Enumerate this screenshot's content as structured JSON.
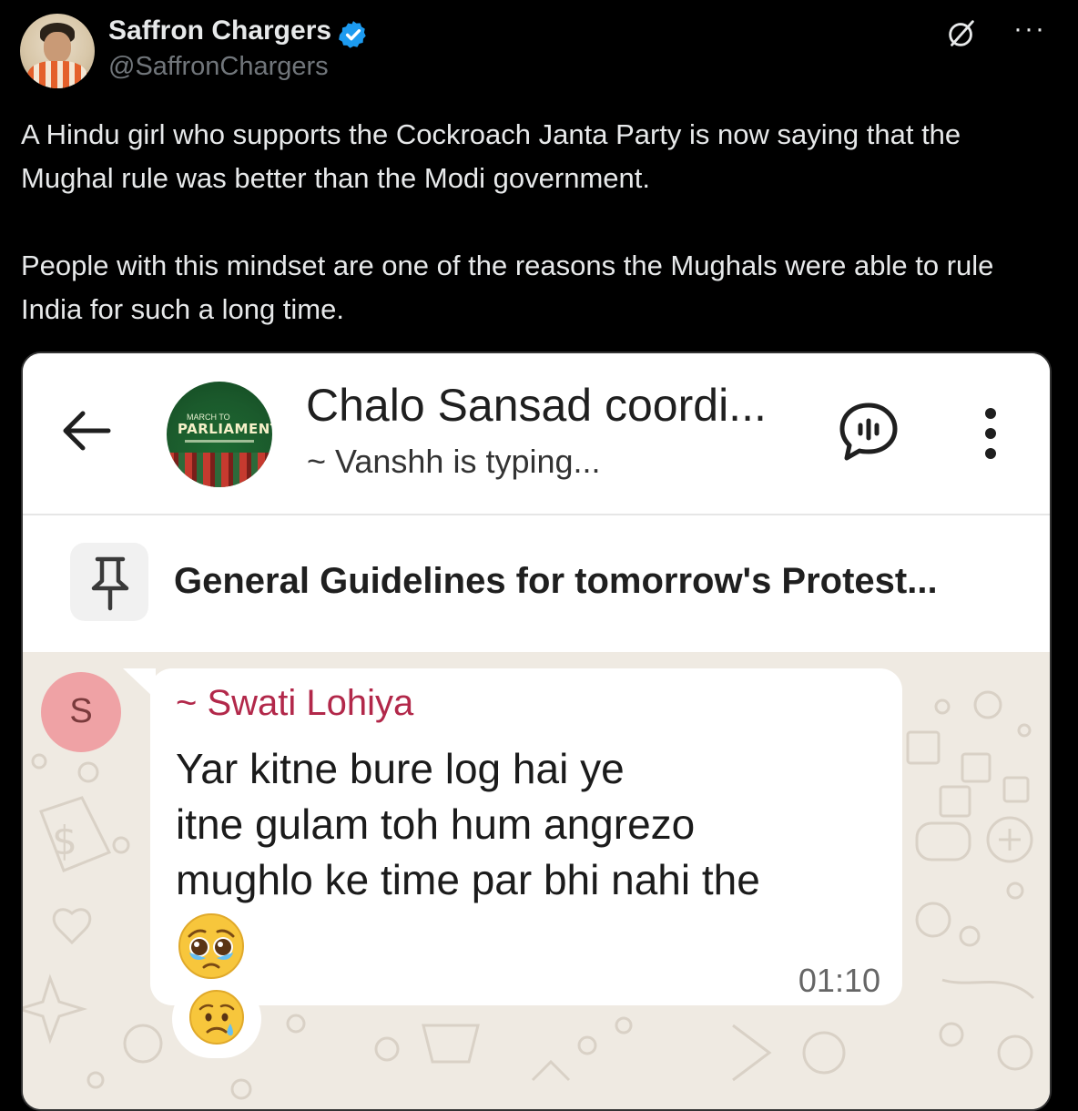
{
  "tweet": {
    "author_name": "Saffron Chargers",
    "author_handle": "@SaffronChargers",
    "paragraphs": [
      "A Hindu girl who supports the Cockroach Janta Party is now saying that the Mughal rule was better than the Modi government.",
      "People with this mindset are one of the reasons the Mughals were able to rule India for such a long time."
    ],
    "icons": [
      "verified-badge-icon",
      "grok-icon",
      "more-options-icon"
    ]
  },
  "chat": {
    "group_name": "Chalo Sansad coordi...",
    "status": "~ Vanshh is typing...",
    "group_avatar": {
      "small_text": "MARCH TO",
      "title": "PARLIAMENT!"
    },
    "pinned_message": "General Guidelines for tomorrow's Protest...",
    "message": {
      "sender_initial": "S",
      "sender_name": "~ Swati Lohiya",
      "text": "Yar kitne bure log hai ye\nitne gulam toh hum angrezo\nmughlo ke time par bhi nahi the",
      "emoji": "pleading-face-with-tears",
      "time": "01:10",
      "reaction": "sad-but-relieved-face"
    },
    "colors": {
      "sender_name": "#b2284a",
      "chat_background": "#efeae2",
      "sender_avatar": "#efa2a5",
      "verified": "#1d9bf0"
    }
  }
}
